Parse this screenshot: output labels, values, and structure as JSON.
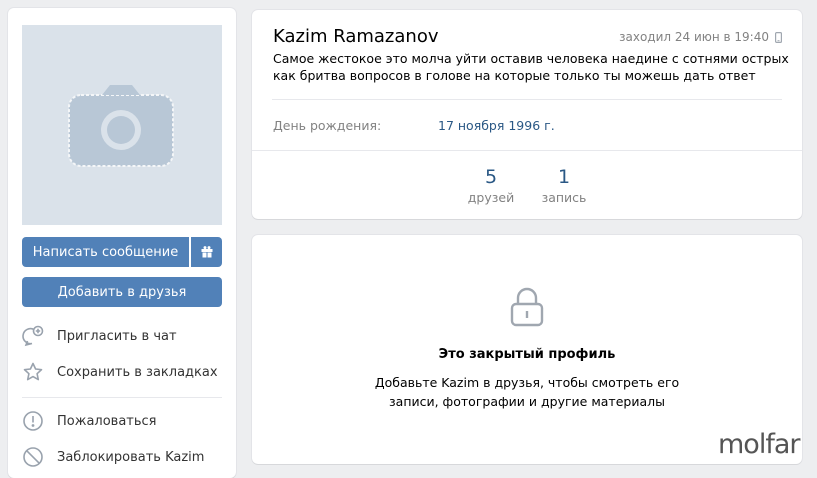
{
  "left": {
    "send_message": "Написать сообщение",
    "add_friend": "Добавить в друзья",
    "actions": [
      {
        "label": "Пригласить в чат",
        "icon": "chat-plus-icon"
      },
      {
        "label": "Сохранить в закладках",
        "icon": "star-icon"
      },
      {
        "label": "Пожаловаться",
        "icon": "report-icon"
      },
      {
        "label": "Заблокировать Kazim",
        "icon": "block-icon"
      }
    ]
  },
  "profile": {
    "name": "Kazim Ramazanov",
    "last_seen": "заходил 24 июн в 19:40",
    "status": "Самое жестокое это молча уйти оставив человека наедине с сотнями острых как бритва вопросов в голове на которые только ты можешь дать ответ",
    "birthday_label": "День рождения:",
    "birthday_value": "17 ноября 1996 г.",
    "counters": [
      {
        "value": "5",
        "label": "друзей"
      },
      {
        "value": "1",
        "label": "запись"
      }
    ]
  },
  "closed": {
    "title": "Это закрытый профиль",
    "description": "Добавьте Kazim в друзья, чтобы смотреть его записи, фотографии и другие материалы"
  },
  "watermark": "molfar",
  "colors": {
    "accent": "#5181b8",
    "link": "#2a5885",
    "background": "#edeef0"
  }
}
